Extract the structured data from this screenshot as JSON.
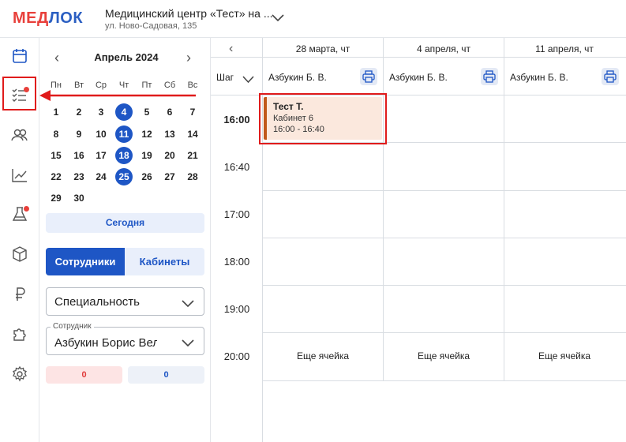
{
  "header": {
    "logo_part1": "МЕД",
    "logo_part2": "ЛОК",
    "clinic_title": "Медицинский центр «Тест» на ...",
    "clinic_address": "ул. Ново-Садовая, 135"
  },
  "rail": {
    "icons": [
      "calendar-icon",
      "tasks-checklist-icon",
      "users-icon",
      "analytics-chart-icon",
      "lab-flask-icon",
      "package-box-icon",
      "ruble-icon",
      "puzzle-icon",
      "settings-gear-icon"
    ]
  },
  "calendar": {
    "month": "Апрель 2024",
    "weekdays": [
      "Пн",
      "Вт",
      "Ср",
      "Чт",
      "Пт",
      "Сб",
      "Вс"
    ],
    "weeks": [
      [
        "1",
        "2",
        "3",
        "4",
        "5",
        "6",
        "7"
      ],
      [
        "8",
        "9",
        "10",
        "11",
        "12",
        "13",
        "14"
      ],
      [
        "15",
        "16",
        "17",
        "18",
        "19",
        "20",
        "21"
      ],
      [
        "22",
        "23",
        "24",
        "25",
        "26",
        "27",
        "28"
      ],
      [
        "29",
        "30"
      ]
    ],
    "selected_days": [
      "4",
      "11",
      "18",
      "25"
    ],
    "today_button": "Сегодня"
  },
  "filters": {
    "tab_staff": "Сотрудники",
    "tab_rooms": "Кабинеты",
    "specialty_placeholder": "Специальность",
    "employee_legend": "Сотрудник",
    "employee_value": "Азбукин Борис Вел",
    "count_red": "0",
    "count_blue": "0"
  },
  "schedule": {
    "step_label": "Шаг",
    "columns": [
      {
        "date": "28 марта, чт",
        "doctor": "Азбукин Б. В."
      },
      {
        "date": "4 апреля, чт",
        "doctor": "Азбукин Б. В."
      },
      {
        "date": "11 апреля, чт",
        "doctor": "Азбукин Б. В."
      }
    ],
    "times": [
      "16:00",
      "16:40",
      "17:00",
      "18:00",
      "19:00",
      "20:00"
    ],
    "more_cell": "Еще ячейка",
    "event": {
      "title": "Тест Т.",
      "room": "Кабинет 6",
      "time": "16:00 - 16:40"
    }
  },
  "colors": {
    "accent_blue": "#1e56c5",
    "brand_red": "#e8403b",
    "event_bg": "#fbe8dd",
    "event_border": "#c0591a",
    "highlight_red": "#e01b1b"
  }
}
